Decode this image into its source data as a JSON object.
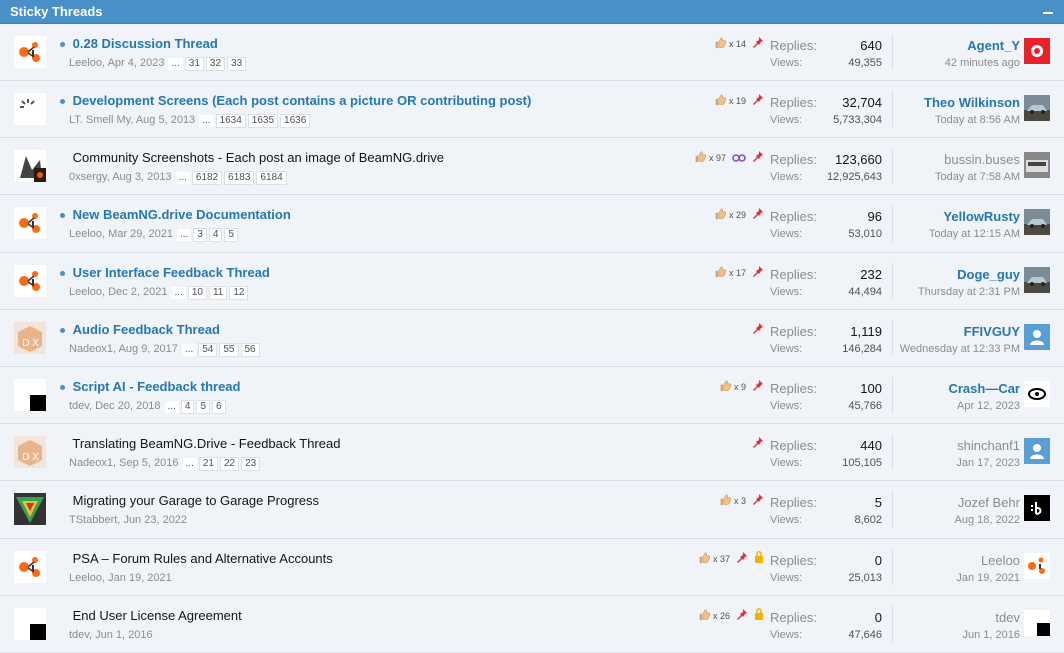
{
  "header": {
    "title": "Sticky Threads"
  },
  "threads": [
    {
      "title": "0.28 Discussion Thread",
      "unread": true,
      "author": "Leeloo",
      "date": "Apr 4, 2023",
      "pages": [
        "31",
        "32",
        "33"
      ],
      "likes": "x 14",
      "pinned": true,
      "locked": false,
      "watch": false,
      "replies": "640",
      "views": "49,355",
      "last_user": "Agent_Y",
      "last_user_bold": true,
      "last_time": "42 minutes ago"
    },
    {
      "title": "Development Screens (Each post contains a picture OR contributing post)",
      "unread": true,
      "author": "LT. Smell My",
      "date": "Aug 5, 2013",
      "pages": [
        "1634",
        "1635",
        "1636"
      ],
      "likes": "x 19",
      "pinned": true,
      "locked": false,
      "watch": false,
      "replies": "32,704",
      "views": "5,733,304",
      "last_user": "Theo Wilkinson",
      "last_user_bold": true,
      "last_time": "Today at 8:56 AM"
    },
    {
      "title": "Community Screenshots - Each post an image of BeamNG.drive",
      "unread": false,
      "author": "0xsergy",
      "date": "Aug 3, 2013",
      "pages": [
        "6182",
        "6183",
        "6184"
      ],
      "likes": "x 97",
      "pinned": true,
      "locked": false,
      "watch": true,
      "replies": "123,660",
      "views": "12,925,643",
      "last_user": "bussin.buses",
      "last_user_bold": false,
      "last_time": "Today at 7:58 AM"
    },
    {
      "title": "New BeamNG.drive Documentation",
      "unread": true,
      "author": "Leeloo",
      "date": "Mar 29, 2021",
      "pages": [
        "3",
        "4",
        "5"
      ],
      "likes": "x 29",
      "pinned": true,
      "locked": false,
      "watch": false,
      "replies": "96",
      "views": "53,010",
      "last_user": "YellowRusty",
      "last_user_bold": true,
      "last_time": "Today at 12:15 AM"
    },
    {
      "title": "User Interface Feedback Thread",
      "unread": true,
      "author": "Leeloo",
      "date": "Dec 2, 2021",
      "pages": [
        "10",
        "11",
        "12"
      ],
      "likes": "x 17",
      "pinned": true,
      "locked": false,
      "watch": false,
      "replies": "232",
      "views": "44,494",
      "last_user": "Doge_guy",
      "last_user_bold": true,
      "last_time": "Thursday at 2:31 PM"
    },
    {
      "title": "Audio Feedback Thread",
      "unread": true,
      "author": "Nadeox1",
      "date": "Aug 9, 2017",
      "pages": [
        "54",
        "55",
        "56"
      ],
      "likes": "",
      "pinned": true,
      "locked": false,
      "watch": false,
      "replies": "1,119",
      "views": "146,284",
      "last_user": "FFIVGUY",
      "last_user_bold": true,
      "last_time": "Wednesday at 12:33 PM"
    },
    {
      "title": "Script AI - Feedback thread",
      "unread": true,
      "author": "tdev",
      "date": "Dec 20, 2018",
      "pages": [
        "4",
        "5",
        "6"
      ],
      "likes": "x 9",
      "pinned": true,
      "locked": false,
      "watch": false,
      "replies": "100",
      "views": "45,766",
      "last_user": "Crash—Car",
      "last_user_bold": true,
      "last_time": "Apr 12, 2023"
    },
    {
      "title": "Translating BeamNG.Drive - Feedback Thread",
      "unread": false,
      "author": "Nadeox1",
      "date": "Sep 5, 2016",
      "pages": [
        "21",
        "22",
        "23"
      ],
      "likes": "",
      "pinned": true,
      "locked": false,
      "watch": false,
      "replies": "440",
      "views": "105,105",
      "last_user": "shinchanf1",
      "last_user_bold": false,
      "last_time": "Jan 17, 2023"
    },
    {
      "title": "Migrating your Garage to Garage Progress",
      "unread": false,
      "author": "TStabbert",
      "date": "Jun 23, 2022",
      "pages": [],
      "likes": "x 3",
      "pinned": true,
      "locked": false,
      "watch": false,
      "replies": "5",
      "views": "8,602",
      "last_user": "Jozef Behr",
      "last_user_bold": false,
      "last_time": "Aug 18, 2022"
    },
    {
      "title": "PSA – Forum Rules and Alternative Accounts",
      "unread": false,
      "author": "Leeloo",
      "date": "Jan 19, 2021",
      "pages": [],
      "likes": "x 37",
      "pinned": true,
      "locked": true,
      "watch": false,
      "replies": "0",
      "views": "25,013",
      "last_user": "Leeloo",
      "last_user_bold": false,
      "last_time": "Jan 19, 2021"
    },
    {
      "title": "End User License Agreement",
      "unread": false,
      "author": "tdev",
      "date": "Jun 1, 2016",
      "pages": [],
      "likes": "x 26",
      "pinned": true,
      "locked": true,
      "watch": false,
      "replies": "0",
      "views": "47,646",
      "last_user": "tdev",
      "last_user_bold": false,
      "last_time": "Jun 1, 2016"
    }
  ],
  "labels": {
    "replies": "Replies:",
    "views": "Views:",
    "ellipsis": "..."
  },
  "colors": {
    "header": "#4a90c8",
    "link": "#2577b1",
    "row_bg": "#f0f4f8",
    "pin": "#d33",
    "lock": "#f0b400"
  },
  "avatar_icons": [
    "beamng-logo-icon",
    "loading-icon",
    "screenshot-icon",
    "beamng-logo-icon",
    "beamng-logo-icon",
    "dx-box-icon",
    "black-square-icon",
    "dx-box-icon",
    "triangle-logo-icon",
    "beamng-logo-icon",
    "black-square-icon"
  ],
  "last_avatar_icons": [
    "red-ring-icon",
    "car-photo-icon",
    "bus-photo-icon",
    "car-photo-icon",
    "car-photo-icon",
    "default-user-icon",
    "eye-logo-icon",
    "default-user-icon",
    "b-logo-icon",
    "beamng-logo-icon",
    "black-square-icon"
  ]
}
